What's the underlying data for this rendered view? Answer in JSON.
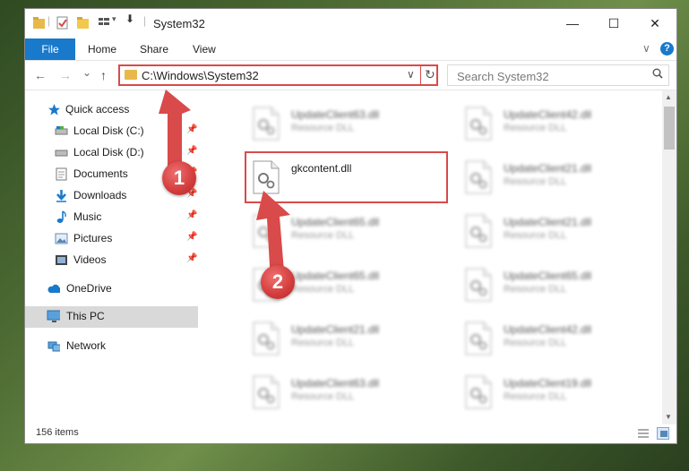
{
  "window": {
    "title": "System32",
    "controls": {
      "minimize": "—",
      "maximize": "☐",
      "close": "✕"
    }
  },
  "ribbon": {
    "file": "File",
    "tabs": [
      "Home",
      "Share",
      "View"
    ],
    "expand_chevron": "∨",
    "help": "?"
  },
  "nav": {
    "back": "←",
    "forward": "→",
    "recent": "⌄",
    "up": "↑",
    "address": "C:\\Windows\\System32",
    "dropdown": "∨",
    "refresh": "↻",
    "search_placeholder": "Search System32",
    "search_icon": "search-icon"
  },
  "sidebar": {
    "items": [
      {
        "label": "Quick access",
        "icon": "star-icon",
        "pinned": false
      },
      {
        "label": "Local Disk (C:)",
        "icon": "drive-icon",
        "pinned": true
      },
      {
        "label": "Local Disk (D:)",
        "icon": "drive-icon",
        "pinned": true
      },
      {
        "label": "Documents",
        "icon": "documents-icon",
        "pinned": true
      },
      {
        "label": "Downloads",
        "icon": "download-icon",
        "pinned": true
      },
      {
        "label": "Music",
        "icon": "music-icon",
        "pinned": true
      },
      {
        "label": "Pictures",
        "icon": "pictures-icon",
        "pinned": true
      },
      {
        "label": "Videos",
        "icon": "videos-icon",
        "pinned": true
      },
      {
        "label": "OneDrive",
        "icon": "cloud-icon",
        "pinned": false
      },
      {
        "label": "This PC",
        "icon": "computer-icon",
        "pinned": false,
        "selected": true
      },
      {
        "label": "Network",
        "icon": "network-icon",
        "pinned": false
      }
    ]
  },
  "files": [
    {
      "name": "UpdateClient63.dll",
      "type": "Resource DLL",
      "blurred": true
    },
    {
      "name": "UpdateClient42.dll",
      "type": "Resource DLL",
      "blurred": true
    },
    {
      "name": "gkcontent.dll",
      "type": "",
      "blurred": false,
      "highlighted": true
    },
    {
      "name": "UpdateClient21.dll",
      "type": "Resource DLL",
      "blurred": true
    },
    {
      "name": "UpdateClient65.dll",
      "type": "Resource DLL",
      "blurred": true
    },
    {
      "name": "UpdateClient21.dll",
      "type": "Resource DLL",
      "blurred": true
    },
    {
      "name": "UpdateClient65.dll",
      "type": "Resource DLL",
      "blurred": true
    },
    {
      "name": "UpdateClient65.dll",
      "type": "Resource DLL",
      "blurred": true
    },
    {
      "name": "UpdateClient21.dll",
      "type": "Resource DLL",
      "blurred": true
    },
    {
      "name": "UpdateClient42.dll",
      "type": "Resource DLL",
      "blurred": true
    },
    {
      "name": "UpdateClient63.dll",
      "type": "Resource DLL",
      "blurred": true
    },
    {
      "name": "UpdateClient19.dll",
      "type": "Resource DLL",
      "blurred": true
    }
  ],
  "status": {
    "items": "156 items"
  },
  "annotations": {
    "step1": "1",
    "step2": "2"
  },
  "colors": {
    "accent": "#1979ca",
    "highlight": "#d94a4a"
  }
}
